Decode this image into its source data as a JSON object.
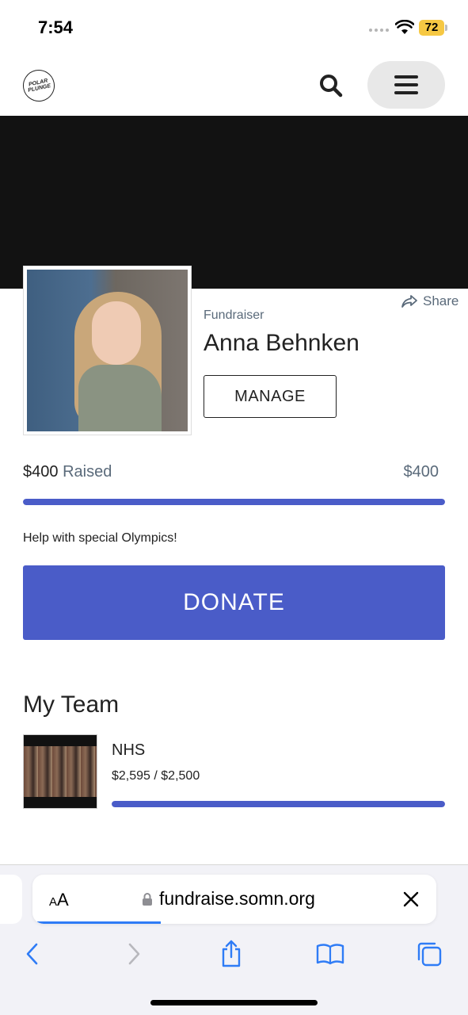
{
  "status_bar": {
    "time": "7:54",
    "battery": "72"
  },
  "header": {
    "logo_text_line1": "POLAR",
    "logo_text_line2": "PLUNGE"
  },
  "profile": {
    "share_label": "Share",
    "role_label": "Fundraiser",
    "name": "Anna Behnken",
    "manage_label": "MANAGE"
  },
  "progress": {
    "raised_amount": "$400",
    "raised_label": "Raised",
    "goal": "$400",
    "fraction": 1.0
  },
  "description": "Help with special Olympics!",
  "donate_label": "DONATE",
  "team": {
    "heading": "My Team",
    "name": "NHS",
    "amount": "$2,595 / $2,500",
    "fraction": 1.0
  },
  "browser": {
    "text_size_label_small": "A",
    "text_size_label_large": "A",
    "url": "fundraise.somn.org"
  },
  "colors": {
    "accent": "#4a5cc8",
    "banner": "#121212",
    "battery": "#f6c843",
    "safari_blue": "#2f7cf6"
  }
}
